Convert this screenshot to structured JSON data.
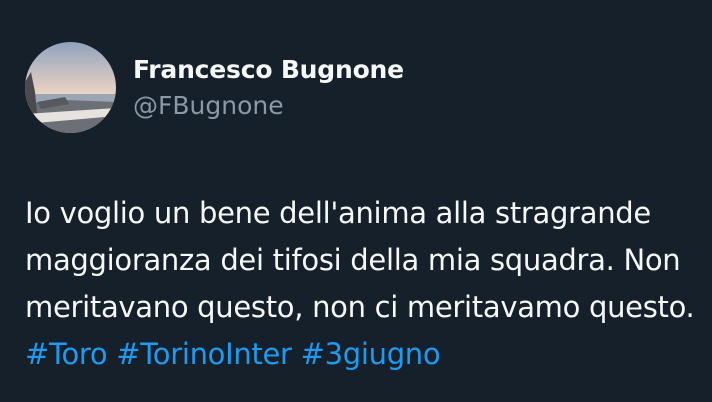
{
  "author": {
    "display_name": "Francesco Bugnone",
    "handle": "@FBugnone",
    "avatar_icon": "profile-photo"
  },
  "tweet": {
    "lines": [
      "Io voglio un bene dell'anima alla stragrande",
      "maggioranza dei tifosi della mia squadra. Non",
      "meritavano questo, non ci meritavamo questo."
    ],
    "hashtags": [
      "#Toro",
      "#TorinoInter",
      "#3giugno"
    ]
  },
  "colors": {
    "background": "#15202b",
    "text": "#f7f9f9",
    "secondary_text": "#8b98a5",
    "link": "#1d9bf0"
  }
}
